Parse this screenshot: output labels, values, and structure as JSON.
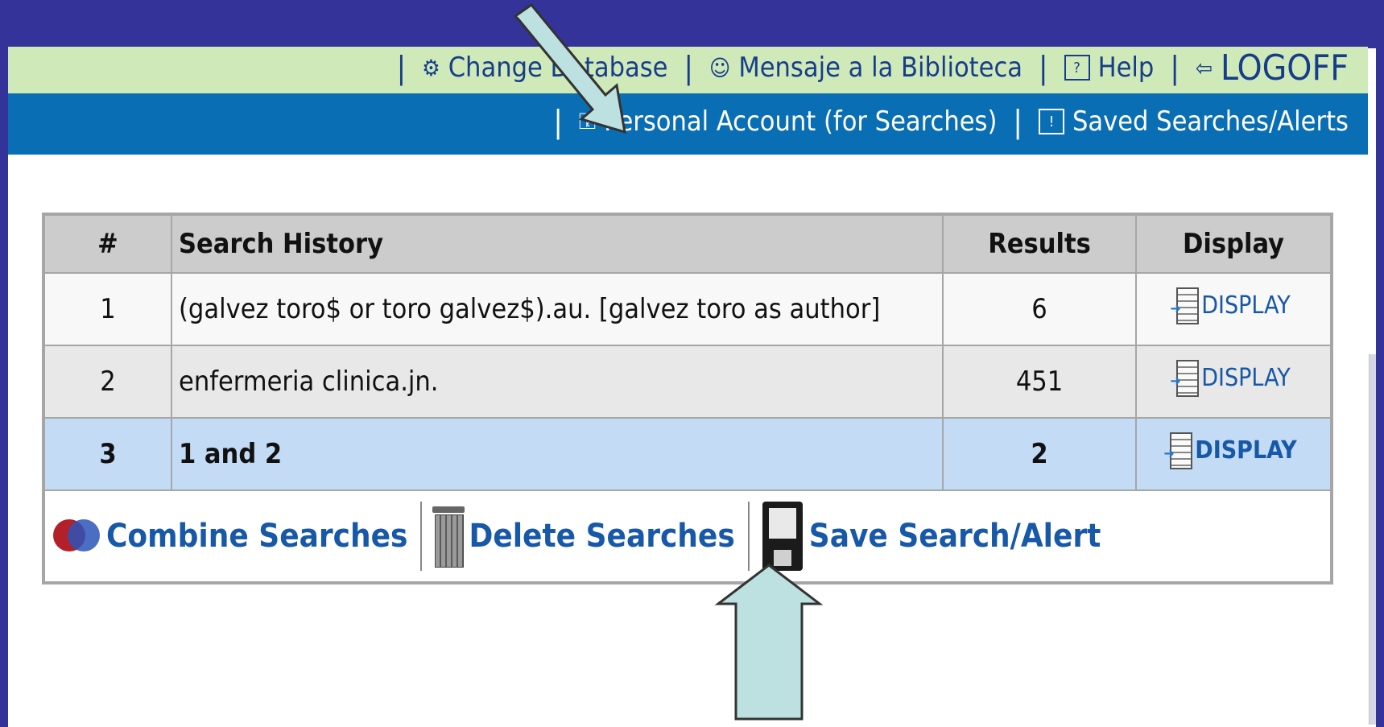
{
  "nav": {
    "top": [
      {
        "id": "change-database",
        "icon": "gear-icon",
        "glyph": "⚙",
        "label": "Change Database"
      },
      {
        "id": "mensaje",
        "icon": "person-icon",
        "glyph": "☺",
        "label": "Mensaje a la Biblioteca"
      },
      {
        "id": "help",
        "icon": "help-icon",
        "glyph": "?",
        "label": "Help"
      },
      {
        "id": "logoff",
        "icon": "logoff-icon",
        "glyph": "⇦",
        "label": "LOGOFF"
      }
    ],
    "account": [
      {
        "id": "personal-account",
        "icon": "person-lock-icon",
        "glyph": "⚿",
        "label": "Personal Account (for Searches)"
      },
      {
        "id": "saved-searches",
        "icon": "saved-search-icon",
        "glyph": "!",
        "label": "Saved Searches/Alerts"
      }
    ],
    "separator": "|"
  },
  "history": {
    "headers": {
      "num": "#",
      "query": "Search History",
      "results": "Results",
      "display": "Display"
    },
    "rows": [
      {
        "num": "1",
        "query": "(galvez toro$ or toro galvez$).au. [galvez toro as author]",
        "results": "6",
        "display": "DISPLAY"
      },
      {
        "num": "2",
        "query": "enfermeria clinica.jn.",
        "results": "451",
        "display": "DISPLAY"
      },
      {
        "num": "3",
        "query": "1 and 2",
        "results": "2",
        "display": "DISPLAY"
      }
    ],
    "actions": {
      "combine": "Combine Searches",
      "delete": "Delete Searches",
      "save": "Save Search/Alert"
    }
  },
  "colors": {
    "frame": "#333399",
    "nav_green": "#cfe9b9",
    "nav_blue": "#0a6eb4",
    "link_blue": "#1758a8",
    "row_selected": "#c3dbf5",
    "arrow_fill": "#bde0e0"
  }
}
